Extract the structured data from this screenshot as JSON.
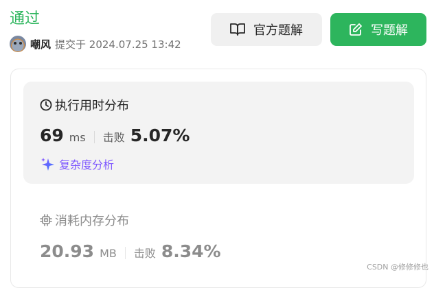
{
  "header": {
    "status": "通过",
    "username": "嘲风",
    "submitted_text": "提交于 2024.07.25 13:42"
  },
  "buttons": {
    "official_solution": "官方题解",
    "write_solution": "写题解"
  },
  "runtime": {
    "title": "执行用时分布",
    "value": "69",
    "unit": "ms",
    "beat_label": "击败",
    "beat_value": "5.07%",
    "analysis_link": "复杂度分析"
  },
  "memory": {
    "title": "消耗内存分布",
    "value": "20.93",
    "unit": "MB",
    "beat_label": "击败",
    "beat_value": "8.34%"
  },
  "watermark": "CSDN @修修修也",
  "colors": {
    "accent_green": "#2db55d",
    "analysis_purple": "#7e57ff",
    "muted_gray": "#8c8c8c"
  }
}
